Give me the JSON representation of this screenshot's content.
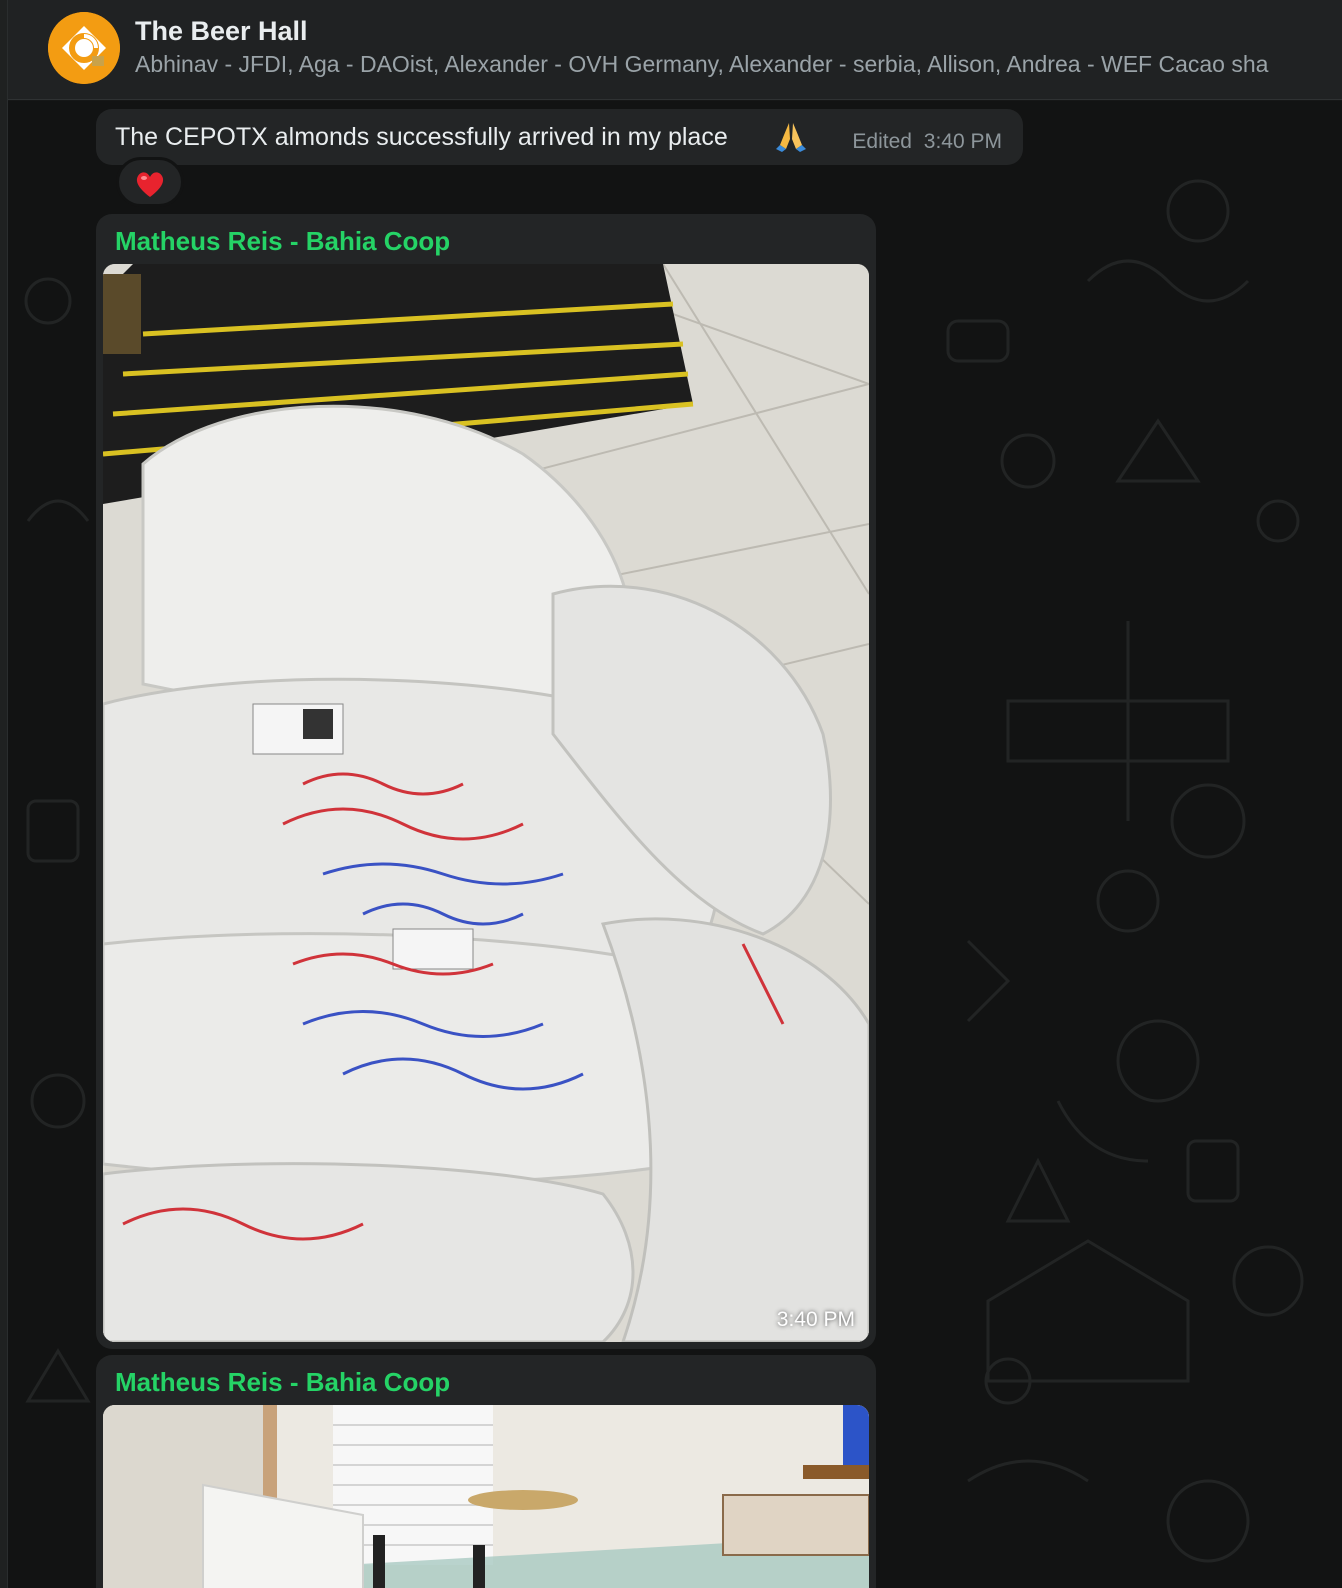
{
  "header": {
    "title": "The Beer Hall",
    "members": "Abhinav - JFDI, Aga - DAOist, Alexander - OVH Germany, Alexander - serbia, Allison, Andrea - WEF Cacao sha",
    "avatar_color": "#f39c12"
  },
  "messages": [
    {
      "type": "text",
      "text": "The CEPOTX almonds successfully arrived in my place",
      "emoji": "folded-hands-emoji",
      "edited_label": "Edited",
      "time": "3:40 PM",
      "reaction": "red-heart-emoji"
    },
    {
      "type": "photo",
      "sender": "Matheus Reis - Bahia Coop",
      "sender_color": "#25d366",
      "image": "white-sacks-photo",
      "time": "3:40 PM"
    },
    {
      "type": "photo",
      "sender": "Matheus Reis - Bahia Coop",
      "sender_color": "#25d366",
      "image": "room-table-photo"
    }
  ]
}
